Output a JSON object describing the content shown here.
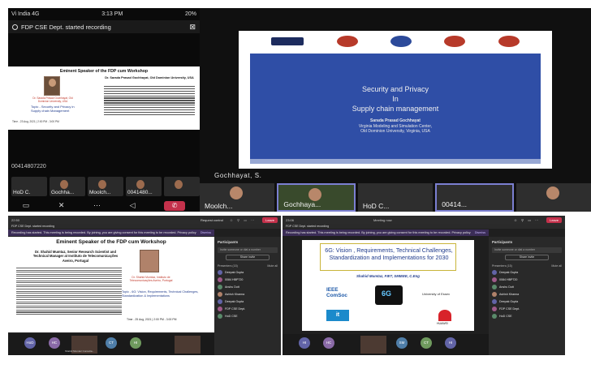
{
  "panel1": {
    "status": {
      "carrier": "Vi India 4G",
      "time": "3:13 PM",
      "battery": "20%"
    },
    "recording_text": "FDP CSE Dept. started recording",
    "slide": {
      "title": "Eminent Speaker of the FDP cum Workshop",
      "left_name": "Dr. Sarada Prasad Gochhayat, Old Dominion University, USA",
      "topic": "Topic - Security and Privacy in Supply chain Management",
      "time": "Time - 23 Aug, 2021 | 2:00 PM - 3:00 PM",
      "right_name": "Dr. Sarada Prasad Gochhayat, Old Dominion University, USA"
    },
    "cam_id": "00414807220",
    "tiles": [
      {
        "name": "HoD C."
      },
      {
        "name": "Gochha..."
      },
      {
        "name": "Moolch..."
      },
      {
        "name": "0041480..."
      },
      {
        "name": ""
      }
    ],
    "controls": [
      "video",
      "mute",
      "more",
      "speaker",
      "hangup"
    ]
  },
  "panel2": {
    "slide": {
      "logos": [
        "OLD DOMINION",
        "Logo",
        "Logo",
        "Logo",
        "Logo"
      ],
      "title_line1": "Security and Privacy",
      "title_line2": "In",
      "title_line3": "Supply chain management",
      "presenter": "Sarada Prasad Gochhayat",
      "affiliation": "Virginia Modeling and Simulation Center,",
      "university": "Old Dominion University, Virginia, USA"
    },
    "speaker_label": "Gochhayat, S.",
    "tiles": [
      {
        "name": "Moolch..."
      },
      {
        "name": "Gochhaya..."
      },
      {
        "name": "HoD C..."
      },
      {
        "name": "00414..."
      },
      {
        "name": ""
      }
    ]
  },
  "panel3": {
    "topbar": {
      "time": "22:50",
      "request": "Request control",
      "leave": "Leave"
    },
    "recnote": "FDP CSE Dept. started recording",
    "banner": {
      "text": "Recording has started. This meeting is being recorded. By joining, you are giving consent for this meeting to be recorded. Privacy policy",
      "dismiss": "Dismiss"
    },
    "slide": {
      "title": "Eminent Speaker of the FDP cum Workshop",
      "head": "Dr. Shahid Mumtaz, Senior Research Scientist and Technical Manager at Instituto de Telecomunicações Aveiro, Portugal",
      "right_name": "Dr. Shahid Mumtaz, Instituto de Telecomunicações Aveiro, Portugal",
      "topic": "Topic - 6G: Vision, Requirements, Technical Challenges, Standardization & Implementations",
      "time": "Time - 25 Aug, 2021 | 2:00 PM - 3:00 PM"
    },
    "sidebar": {
      "title": "Participants",
      "invite_placeholder": "Invite someone or dial a number",
      "share": "Share invite",
      "section": "Presenters (15)",
      "mute_all": "Mute all",
      "people": [
        "Deepak Gupta",
        "0084 HBP720",
        "Anshu Dutt",
        "Ashish Khanna",
        "Deepak Gupta",
        "FDP CSE Dept.",
        "HoD CSE"
      ]
    },
    "strip": [
      {
        "initials": "HoD"
      },
      {
        "initials": "HC"
      },
      {
        "initials": "Shahid Mumtaz Consulta..."
      },
      {
        "initials": "CT"
      },
      {
        "initials": "HI"
      }
    ]
  },
  "panel4": {
    "topbar": {
      "time": "23:06",
      "title": "Meeting now",
      "leave": "Leave"
    },
    "recnote": "FDP CSE Dept. started recording",
    "banner": {
      "text": "Recording has started. This meeting is being recorded. By joining, you are giving consent for this meeting to be recorded. Privacy policy",
      "dismiss": "Dismiss"
    },
    "slide": {
      "title": "6G: Vision , Requirements, Technical Challenges, Standardization and Implementations for 2030",
      "author": "Shahid Mumtaz, FIET, SMIEEE, C.Eng",
      "ieee": "IEEE ComSoc",
      "tv_text": "6G",
      "university": "University of Essex",
      "huawei": "HUAWEI"
    },
    "sidebar": {
      "title": "Participants",
      "invite_placeholder": "Invite someone or dial a number",
      "share": "Share invite",
      "section": "Presenters (15)",
      "mute_all": "Mute all",
      "people": [
        "Deepak Gupta",
        "0084 HBP720",
        "Anshu Dutt",
        "Ashish Khanna",
        "Deepak Gupta",
        "FDP CSE Dept.",
        "HoD CSE"
      ]
    },
    "strip": [
      {
        "initials": "HI"
      },
      {
        "initials": "HC"
      },
      {
        "initials": "SM"
      },
      {
        "initials": "CT"
      },
      {
        "initials": "HI"
      }
    ]
  }
}
